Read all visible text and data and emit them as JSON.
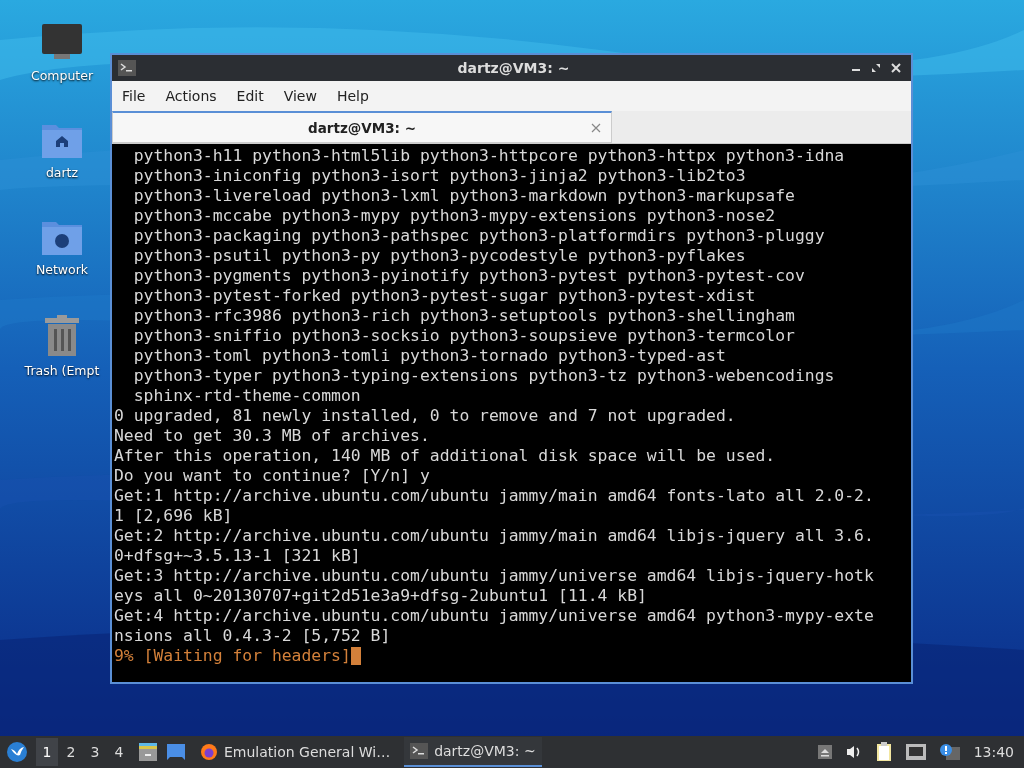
{
  "desktop_icons": [
    {
      "label": "Computer",
      "kind": "computer"
    },
    {
      "label": "dartz",
      "kind": "home"
    },
    {
      "label": "Network",
      "kind": "network"
    },
    {
      "label": "Trash (Empt",
      "kind": "trash"
    }
  ],
  "window": {
    "title": "dartz@VM3: ~",
    "menu": [
      "File",
      "Actions",
      "Edit",
      "View",
      "Help"
    ],
    "tabs": [
      {
        "label": "dartz@VM3: ~",
        "selected": true
      }
    ],
    "terminal_lines": [
      {
        "text": "  python3-h11 python3-html5lib python3-httpcore python3-httpx python3-idna",
        "kind": "normal"
      },
      {
        "text": "  python3-iniconfig python3-isort python3-jinja2 python3-lib2to3",
        "kind": "normal"
      },
      {
        "text": "  python3-livereload python3-lxml python3-markdown python3-markupsafe",
        "kind": "normal"
      },
      {
        "text": "  python3-mccabe python3-mypy python3-mypy-extensions python3-nose2",
        "kind": "normal"
      },
      {
        "text": "  python3-packaging python3-pathspec python3-platformdirs python3-pluggy",
        "kind": "normal"
      },
      {
        "text": "  python3-psutil python3-py python3-pycodestyle python3-pyflakes",
        "kind": "normal"
      },
      {
        "text": "  python3-pygments python3-pyinotify python3-pytest python3-pytest-cov",
        "kind": "normal"
      },
      {
        "text": "  python3-pytest-forked python3-pytest-sugar python3-pytest-xdist",
        "kind": "normal"
      },
      {
        "text": "  python3-rfc3986 python3-rich python3-setuptools python3-shellingham",
        "kind": "normal"
      },
      {
        "text": "  python3-sniffio python3-socksio python3-soupsieve python3-termcolor",
        "kind": "normal"
      },
      {
        "text": "  python3-toml python3-tomli python3-tornado python3-typed-ast",
        "kind": "normal"
      },
      {
        "text": "  python3-typer python3-typing-extensions python3-tz python3-webencodings",
        "kind": "normal"
      },
      {
        "text": "  sphinx-rtd-theme-common",
        "kind": "normal"
      },
      {
        "text": "0 upgraded, 81 newly installed, 0 to remove and 7 not upgraded.",
        "kind": "normal"
      },
      {
        "text": "Need to get 30.3 MB of archives.",
        "kind": "normal"
      },
      {
        "text": "After this operation, 140 MB of additional disk space will be used.",
        "kind": "normal"
      },
      {
        "text": "Do you want to continue? [Y/n] y",
        "kind": "normal"
      },
      {
        "text": "Get:1 http://archive.ubuntu.com/ubuntu jammy/main amd64 fonts-lato all 2.0-2.",
        "kind": "normal"
      },
      {
        "text": "1 [2,696 kB]",
        "kind": "normal"
      },
      {
        "text": "Get:2 http://archive.ubuntu.com/ubuntu jammy/main amd64 libjs-jquery all 3.6.",
        "kind": "normal"
      },
      {
        "text": "0+dfsg+~3.5.13-1 [321 kB]",
        "kind": "normal"
      },
      {
        "text": "Get:3 http://archive.ubuntu.com/ubuntu jammy/universe amd64 libjs-jquery-hotk",
        "kind": "normal"
      },
      {
        "text": "eys all 0~20130707+git2d51e3a9+dfsg-2ubuntu1 [11.4 kB]",
        "kind": "normal"
      },
      {
        "text": "Get:4 http://archive.ubuntu.com/ubuntu jammy/universe amd64 python3-mypy-exte",
        "kind": "normal"
      },
      {
        "text": "nsions all 0.4.3-2 [5,752 B]",
        "kind": "normal"
      },
      {
        "text": "9% [Waiting for headers]",
        "kind": "progress",
        "cursor": true
      }
    ]
  },
  "taskbar": {
    "workspaces": [
      {
        "label": "1",
        "selected": true
      },
      {
        "label": "2",
        "selected": false
      },
      {
        "label": "3",
        "selected": false
      },
      {
        "label": "4",
        "selected": false
      }
    ],
    "tasks": [
      {
        "label": "Emulation General Wi…",
        "kind": "browser",
        "selected": false
      },
      {
        "label": "dartz@VM3: ~",
        "kind": "terminal",
        "selected": true
      }
    ],
    "clock": "13:40"
  }
}
